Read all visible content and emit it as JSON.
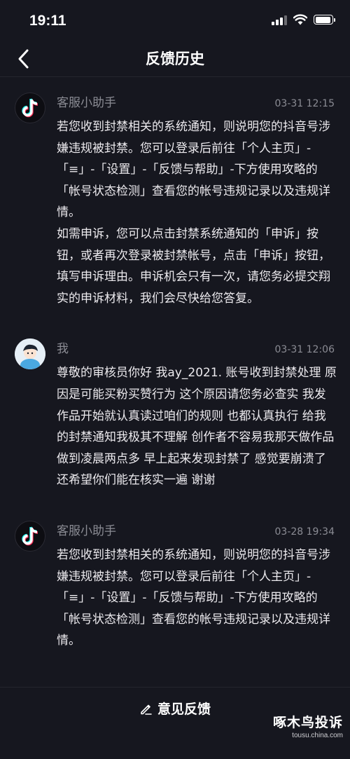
{
  "status_bar": {
    "time": "19:11"
  },
  "nav": {
    "title": "反馈历史"
  },
  "messages": [
    {
      "sender": "客服小助手",
      "time": "03-31 12:15",
      "avatar_icon": "tiktok-logo-icon",
      "paragraphs": [
        "若您收到封禁相关的系统通知，则说明您的抖音号涉嫌违规被封禁。您可以登录后前往「个人主页」-「≡」-「设置」-「反馈与帮助」-下方使用攻略的「帐号状态检测」查看您的帐号违规记录以及违规详情。",
        "如需申诉，您可以点击封禁系统通知的「申诉」按钮，或者再次登录被封禁帐号，点击「申诉」按钮，填写申诉理由。申诉机会只有一次，请您务必提交翔实的申诉材料，我们会尽快给您答复。"
      ]
    },
    {
      "sender": "我",
      "time": "03-31 12:06",
      "avatar_icon": "user-avatar-icon",
      "paragraphs": [
        "尊敬的审核员你好 我ay_2021. 账号收到封禁处理 原因是可能买粉买赞行为 这个原因请您务必查实 我发作品开始就认真读过咱们的规则 也都认真执行 给我的封禁通知我极其不理解 创作者不容易我那天做作品做到凌晨两点多 早上起来发现封禁了 感觉要崩溃了 还希望你们能在核实一遍 谢谢"
      ]
    },
    {
      "sender": "客服小助手",
      "time": "03-28 19:34",
      "avatar_icon": "tiktok-logo-icon",
      "paragraphs": [
        "若您收到封禁相关的系统通知，则说明您的抖音号涉嫌违规被封禁。您可以登录后前往「个人主页」-「≡」-「设置」-「反馈与帮助」-下方使用攻略的「帐号状态检测」查看您的帐号违规记录以及违规详情。"
      ]
    }
  ],
  "bottom": {
    "feedback_label": "意见反馈"
  },
  "watermark": {
    "title": "啄木鸟投诉",
    "subtitle": "tousu.china.com"
  },
  "colors": {
    "background": "#16171f",
    "meta_text": "#8b8c94",
    "body_text": "#eceaee",
    "tiktok_cyan": "#25f4ee",
    "tiktok_red": "#fe2c55"
  }
}
